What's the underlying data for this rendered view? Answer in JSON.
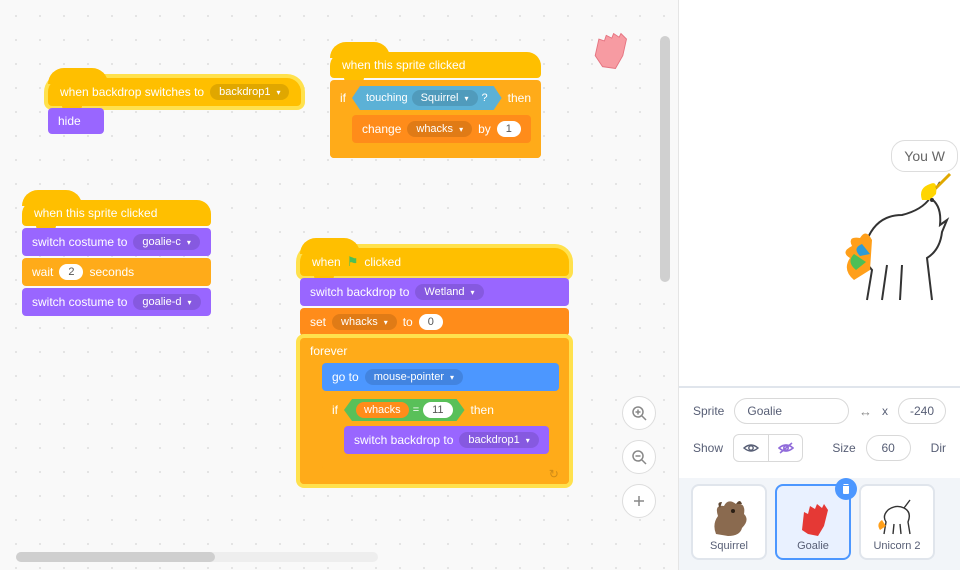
{
  "stage": {
    "youWin": "You W"
  },
  "scripts": {
    "s1": {
      "hat": "when backdrop switches to",
      "hatArg": "backdrop1",
      "hide": "hide"
    },
    "s2": {
      "hat": "when this sprite clicked",
      "switch1_label": "switch costume to",
      "switch1_arg": "goalie-c",
      "wait_pre": "wait",
      "wait_val": "2",
      "wait_post": "seconds",
      "switch2_label": "switch costume to",
      "switch2_arg": "goalie-d"
    },
    "s3": {
      "hat": "when this sprite clicked",
      "if_label": "if",
      "then_label": "then",
      "touching_label": "touching",
      "touching_arg": "Squirrel",
      "question": "?",
      "change_label": "change",
      "change_var": "whacks",
      "by_label": "by",
      "by_val": "1"
    },
    "s4": {
      "hat_pre": "when",
      "hat_post": "clicked",
      "switchBackdrop_label": "switch backdrop to",
      "switchBackdrop_arg": "Wetland",
      "set_label": "set",
      "set_var": "whacks",
      "to_label": "to",
      "to_val": "0",
      "forever_label": "forever",
      "goto_label": "go to",
      "goto_arg": "mouse-pointer",
      "if_label": "if",
      "then_label": "then",
      "eq_var": "whacks",
      "eq_op": "=",
      "eq_val": "11",
      "switchBackdrop2_label": "switch backdrop to",
      "switchBackdrop2_arg": "backdrop1"
    }
  },
  "spriteInfo": {
    "spriteLabel": "Sprite",
    "name": "Goalie",
    "xLabel": "x",
    "xVal": "-240",
    "showLabel": "Show",
    "sizeLabel": "Size",
    "sizeVal": "60",
    "dirLabel": "Dir"
  },
  "sprites": {
    "squirrel": "Squirrel",
    "goalie": "Goalie",
    "unicorn2": "Unicorn 2"
  }
}
